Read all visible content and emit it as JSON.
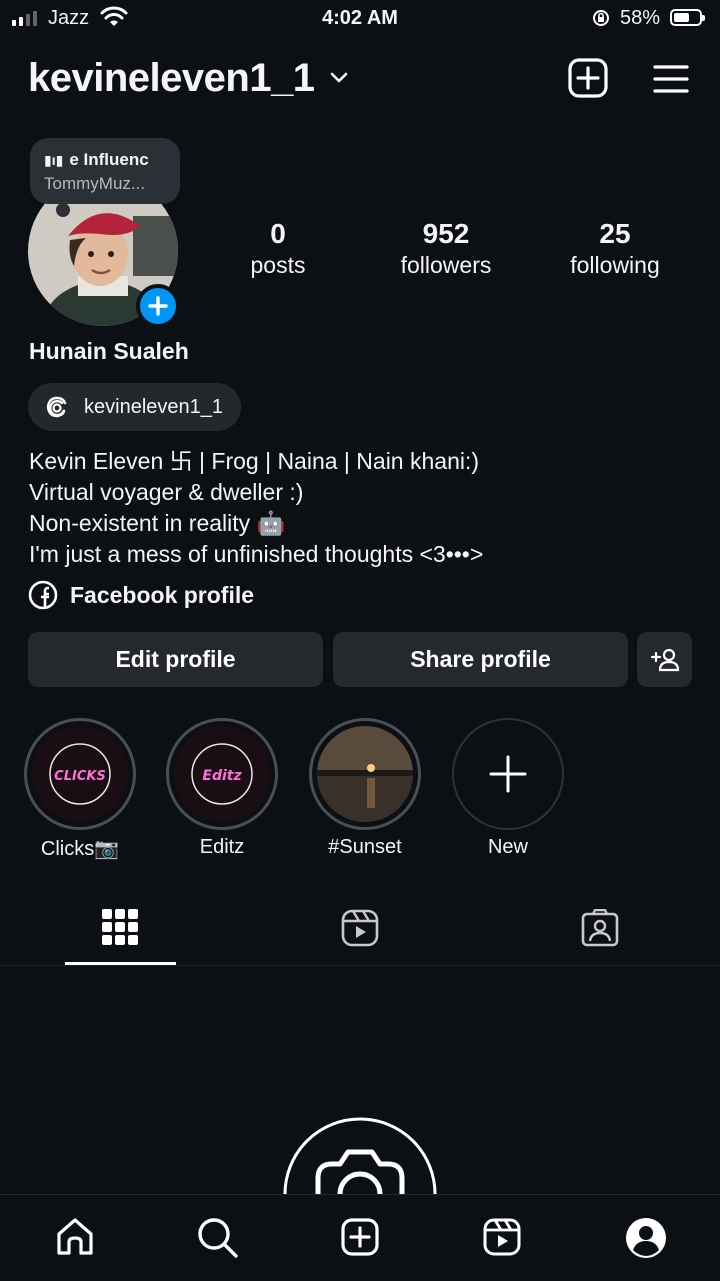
{
  "status_bar": {
    "carrier": "Jazz",
    "time": "4:02 AM",
    "battery": "58%"
  },
  "header": {
    "username": "kevineleven1_1"
  },
  "note": {
    "line1": "e Influenc",
    "line2": "TommyMuz..."
  },
  "stats": [
    {
      "count": "0",
      "label": "posts"
    },
    {
      "count": "952",
      "label": "followers"
    },
    {
      "count": "25",
      "label": "following"
    }
  ],
  "profile": {
    "full_name": "Hunain Sualeh",
    "threads_handle": "kevineleven1_1",
    "bio": [
      "Kevin Eleven 卐 | Frog | Naina | Nain khani:)",
      "Virtual voyager & dweller :)",
      "Non-existent in reality 🤖",
      "I'm just a mess of unfinished thoughts <3•••>"
    ],
    "facebook_link": "Facebook profile"
  },
  "buttons": {
    "edit": "Edit profile",
    "share": "Share profile"
  },
  "highlights": [
    {
      "label": "Clicks📷",
      "cover_text": "CLICKS"
    },
    {
      "label": "Editz",
      "cover_text": "Editz"
    },
    {
      "label": "#Sunset"
    },
    {
      "label": "New"
    }
  ],
  "colors": {
    "background": "#0c1014",
    "button": "#25292e",
    "accent_blue": "#0095f6"
  }
}
